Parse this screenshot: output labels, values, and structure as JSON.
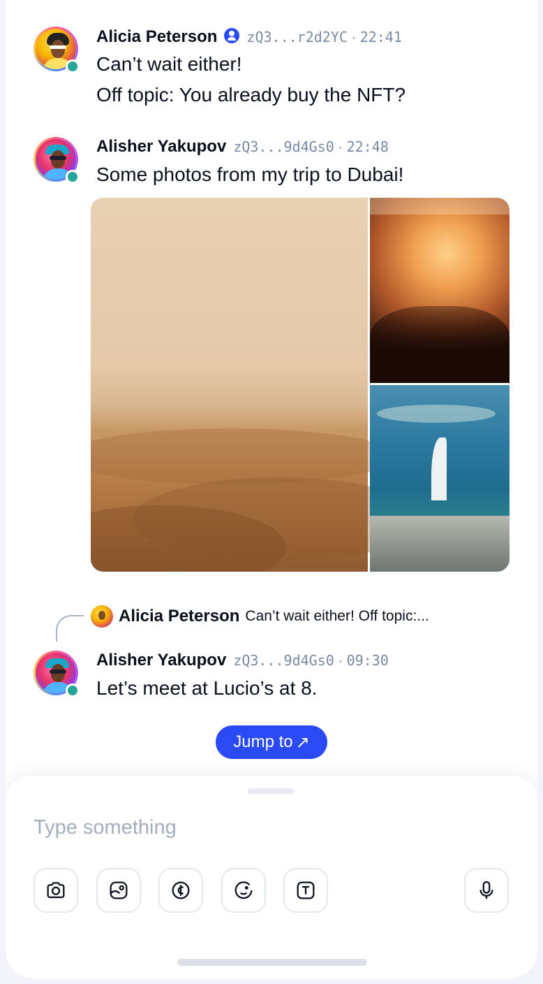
{
  "messages": [
    {
      "author": "Alicia Peterson",
      "verified": true,
      "key": "zQ3...r2d2YC",
      "separator": " · ",
      "time": "22:41",
      "lines": [
        "Can’t wait either!",
        "Off topic: You already buy the NFT?"
      ]
    },
    {
      "author": "Alisher Yakupov",
      "key": "zQ3...9d4Gs0",
      "separator": " · ",
      "time": "22:48",
      "lines": [
        "Some photos from my trip to Dubai!"
      ]
    },
    {
      "author": "Alisher Yakupov",
      "key": "zQ3...9d4Gs0",
      "separator": " · ",
      "time": "09:30",
      "lines": [
        "Let’s meet at Lucio’s at 8."
      ]
    }
  ],
  "reply": {
    "author": "Alicia Peterson",
    "snippet": "Can’t wait either! Off topic:..."
  },
  "jump": {
    "label": "Jump to",
    "arrow": "↗"
  },
  "composer": {
    "placeholder": "Type something",
    "tools": [
      "camera-icon",
      "image-icon",
      "coin-icon",
      "emoji-icon",
      "text-format-icon"
    ],
    "mic": "microphone-icon"
  },
  "colors": {
    "accent": "#2a4af5",
    "online": "#26a69a",
    "meta": "#7a8aa3",
    "text": "#09101c"
  }
}
